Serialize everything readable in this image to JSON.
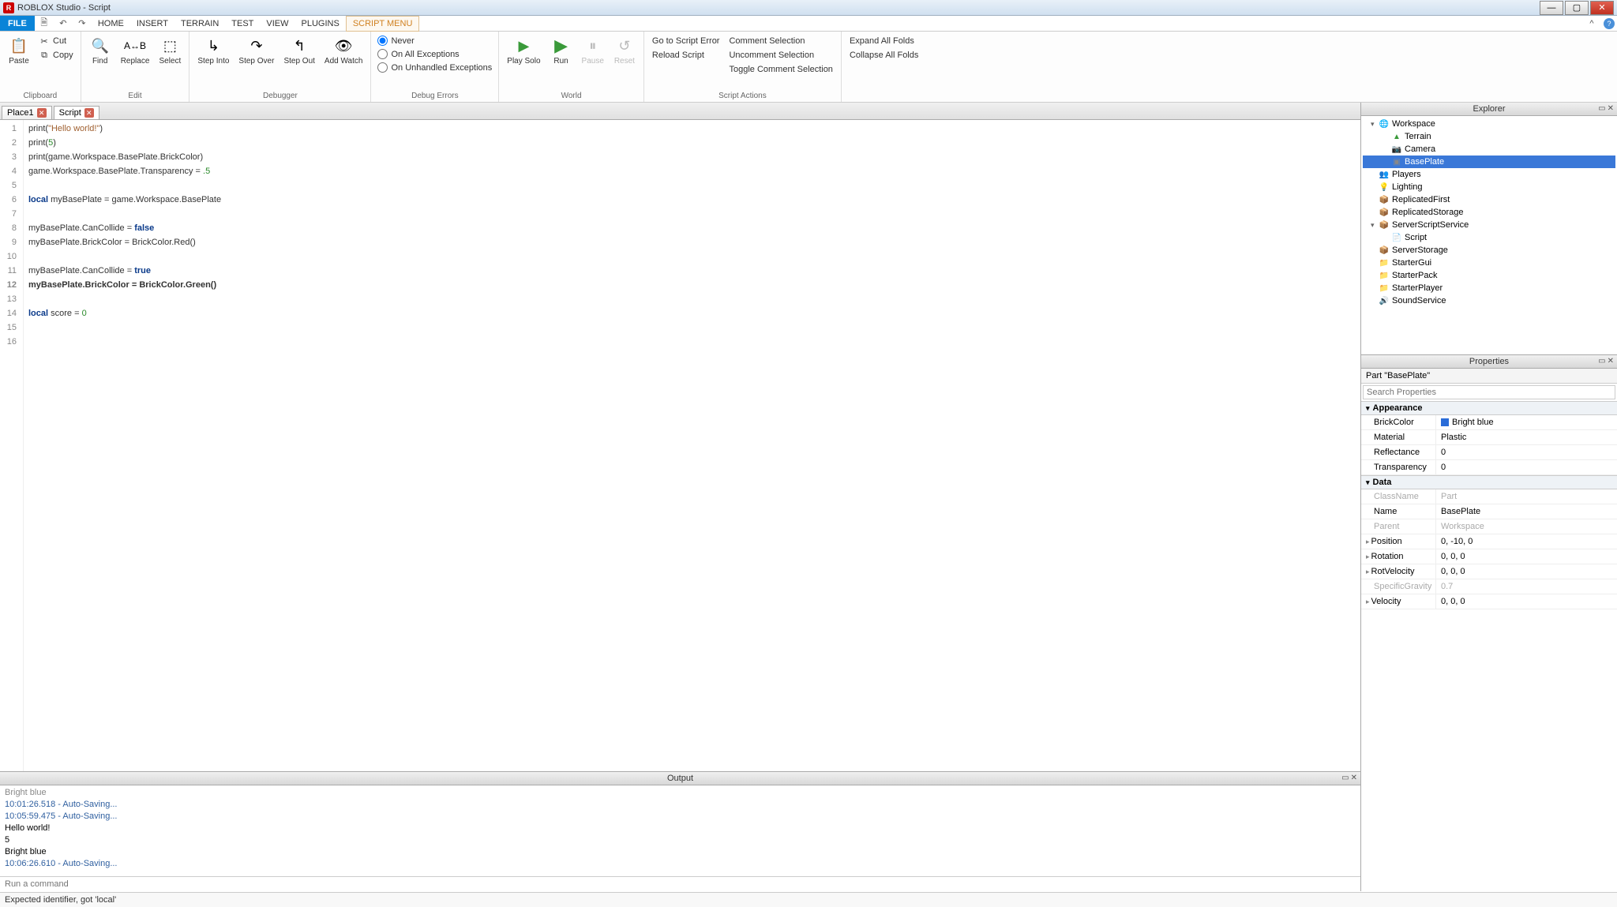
{
  "titlebar": {
    "title": "ROBLOX Studio - Script"
  },
  "menubar": {
    "file": "FILE",
    "items": [
      "HOME",
      "INSERT",
      "TERRAIN",
      "TEST",
      "VIEW",
      "PLUGINS",
      "SCRIPT MENU"
    ],
    "active_index": 6
  },
  "ribbon": {
    "clipboard": {
      "label": "Clipboard",
      "paste": "Paste",
      "cut": "Cut",
      "copy": "Copy"
    },
    "edit": {
      "label": "Edit",
      "find": "Find",
      "replace": "Replace",
      "select": "Select"
    },
    "debugger": {
      "label": "Debugger",
      "step_into": "Step\nInto",
      "step_over": "Step\nOver",
      "step_out": "Step\nOut",
      "add_watch": "Add\nWatch"
    },
    "debug_errors": {
      "label": "Debug Errors",
      "never": "Never",
      "on_all": "On All Exceptions",
      "on_unhandled": "On Unhandled Exceptions"
    },
    "world": {
      "label": "World",
      "play_solo": "Play\nSolo",
      "run": "Run",
      "pause": "Pause",
      "reset": "Reset"
    },
    "script_actions": {
      "label": "Script Actions",
      "goto_error": "Go to Script Error",
      "reload": "Reload Script",
      "comment": "Comment Selection",
      "uncomment": "Uncomment Selection",
      "toggle_comment": "Toggle Comment Selection"
    },
    "folds": {
      "expand": "Expand All Folds",
      "collapse": "Collapse All Folds"
    }
  },
  "doc_tabs": [
    {
      "label": "Place1",
      "closable": true,
      "active": false
    },
    {
      "label": "Script",
      "closable": true,
      "active": true
    }
  ],
  "code_lines": [
    {
      "n": 1,
      "html": "print(<span class='str'>\"Hello world!\"</span>)"
    },
    {
      "n": 2,
      "html": "print(<span class='num'>5</span>)"
    },
    {
      "n": 3,
      "html": "print(game.Workspace.BasePlate.BrickColor)"
    },
    {
      "n": 4,
      "html": "game.Workspace.BasePlate.Transparency = <span class='num'>.5</span>"
    },
    {
      "n": 5,
      "html": ""
    },
    {
      "n": 6,
      "html": "<span class='kw'>local</span> myBasePlate = game.Workspace.BasePlate"
    },
    {
      "n": 7,
      "html": ""
    },
    {
      "n": 8,
      "html": "myBasePlate.CanCollide = <span class='kw'>false</span>"
    },
    {
      "n": 9,
      "html": "myBasePlate.BrickColor = BrickColor.Red()"
    },
    {
      "n": 10,
      "html": ""
    },
    {
      "n": 11,
      "html": "myBasePlate.CanCollide = <span class='kw'>true</span>"
    },
    {
      "n": 12,
      "html": "myBasePlate.BrickColor = BrickColor.Green()",
      "current": true
    },
    {
      "n": 13,
      "html": ""
    },
    {
      "n": 14,
      "html": "<span class='kw'>local</span> score = <span class='num'>0</span>"
    },
    {
      "n": 15,
      "html": ""
    },
    {
      "n": 16,
      "html": ""
    }
  ],
  "output": {
    "title": "Output",
    "lines": [
      {
        "text": "Bright blue",
        "cls": "out-gray"
      },
      {
        "text": "10:01:26.518 - Auto-Saving...",
        "cls": "out-blue"
      },
      {
        "text": "10:05:59.475 - Auto-Saving...",
        "cls": "out-blue"
      },
      {
        "text": "Hello world!",
        "cls": ""
      },
      {
        "text": "5",
        "cls": ""
      },
      {
        "text": "Bright blue",
        "cls": ""
      },
      {
        "text": "10:06:26.610 - Auto-Saving...",
        "cls": "out-blue"
      }
    ],
    "cmd_placeholder": "Run a command"
  },
  "status": "Expected identifier, got 'local'",
  "explorer": {
    "title": "Explorer",
    "tree": [
      {
        "indent": 0,
        "toggle": "▾",
        "icon": "🌐",
        "label": "Workspace",
        "color": "#4a90d9"
      },
      {
        "indent": 1,
        "toggle": "",
        "icon": "▲",
        "label": "Terrain",
        "color": "#3a9a3a"
      },
      {
        "indent": 1,
        "toggle": "",
        "icon": "📷",
        "label": "Camera",
        "color": "#888"
      },
      {
        "indent": 1,
        "toggle": "",
        "icon": "▣",
        "label": "BasePlate",
        "selected": true,
        "color": "#888"
      },
      {
        "indent": 0,
        "toggle": "",
        "icon": "👥",
        "label": "Players",
        "color": "#d0a030"
      },
      {
        "indent": 0,
        "toggle": "",
        "icon": "💡",
        "label": "Lighting",
        "color": "#d0a030"
      },
      {
        "indent": 0,
        "toggle": "",
        "icon": "📦",
        "label": "ReplicatedFirst",
        "color": "#b08040"
      },
      {
        "indent": 0,
        "toggle": "",
        "icon": "📦",
        "label": "ReplicatedStorage",
        "color": "#b08040"
      },
      {
        "indent": 0,
        "toggle": "▾",
        "icon": "📦",
        "label": "ServerScriptService",
        "color": "#b08040"
      },
      {
        "indent": 1,
        "toggle": "",
        "icon": "📄",
        "label": "Script",
        "color": "#888"
      },
      {
        "indent": 0,
        "toggle": "",
        "icon": "📦",
        "label": "ServerStorage",
        "color": "#b08040"
      },
      {
        "indent": 0,
        "toggle": "",
        "icon": "📁",
        "label": "StarterGui",
        "color": "#d0a030"
      },
      {
        "indent": 0,
        "toggle": "",
        "icon": "📁",
        "label": "StarterPack",
        "color": "#d0a030"
      },
      {
        "indent": 0,
        "toggle": "",
        "icon": "📁",
        "label": "StarterPlayer",
        "color": "#d0a030"
      },
      {
        "indent": 0,
        "toggle": "",
        "icon": "🔊",
        "label": "SoundService",
        "color": "#888"
      }
    ]
  },
  "properties": {
    "title": "Properties",
    "header": "Part \"BasePlate\"",
    "search_placeholder": "Search Properties",
    "categories": [
      {
        "name": "Appearance",
        "rows": [
          {
            "name": "BrickColor",
            "val": "Bright blue",
            "swatch": true
          },
          {
            "name": "Material",
            "val": "Plastic"
          },
          {
            "name": "Reflectance",
            "val": "0"
          },
          {
            "name": "Transparency",
            "val": "0"
          }
        ]
      },
      {
        "name": "Data",
        "rows": [
          {
            "name": "ClassName",
            "val": "Part",
            "readonly": true
          },
          {
            "name": "Name",
            "val": "BasePlate"
          },
          {
            "name": "Parent",
            "val": "Workspace",
            "readonly": true
          },
          {
            "name": "Position",
            "val": "0, -10, 0",
            "expand": true
          },
          {
            "name": "Rotation",
            "val": "0, 0, 0",
            "expand": true
          },
          {
            "name": "RotVelocity",
            "val": "0, 0, 0",
            "expand": true
          },
          {
            "name": "SpecificGravity",
            "val": "0.7",
            "readonly": true
          },
          {
            "name": "Velocity",
            "val": "0, 0, 0",
            "expand": true
          }
        ]
      }
    ]
  }
}
